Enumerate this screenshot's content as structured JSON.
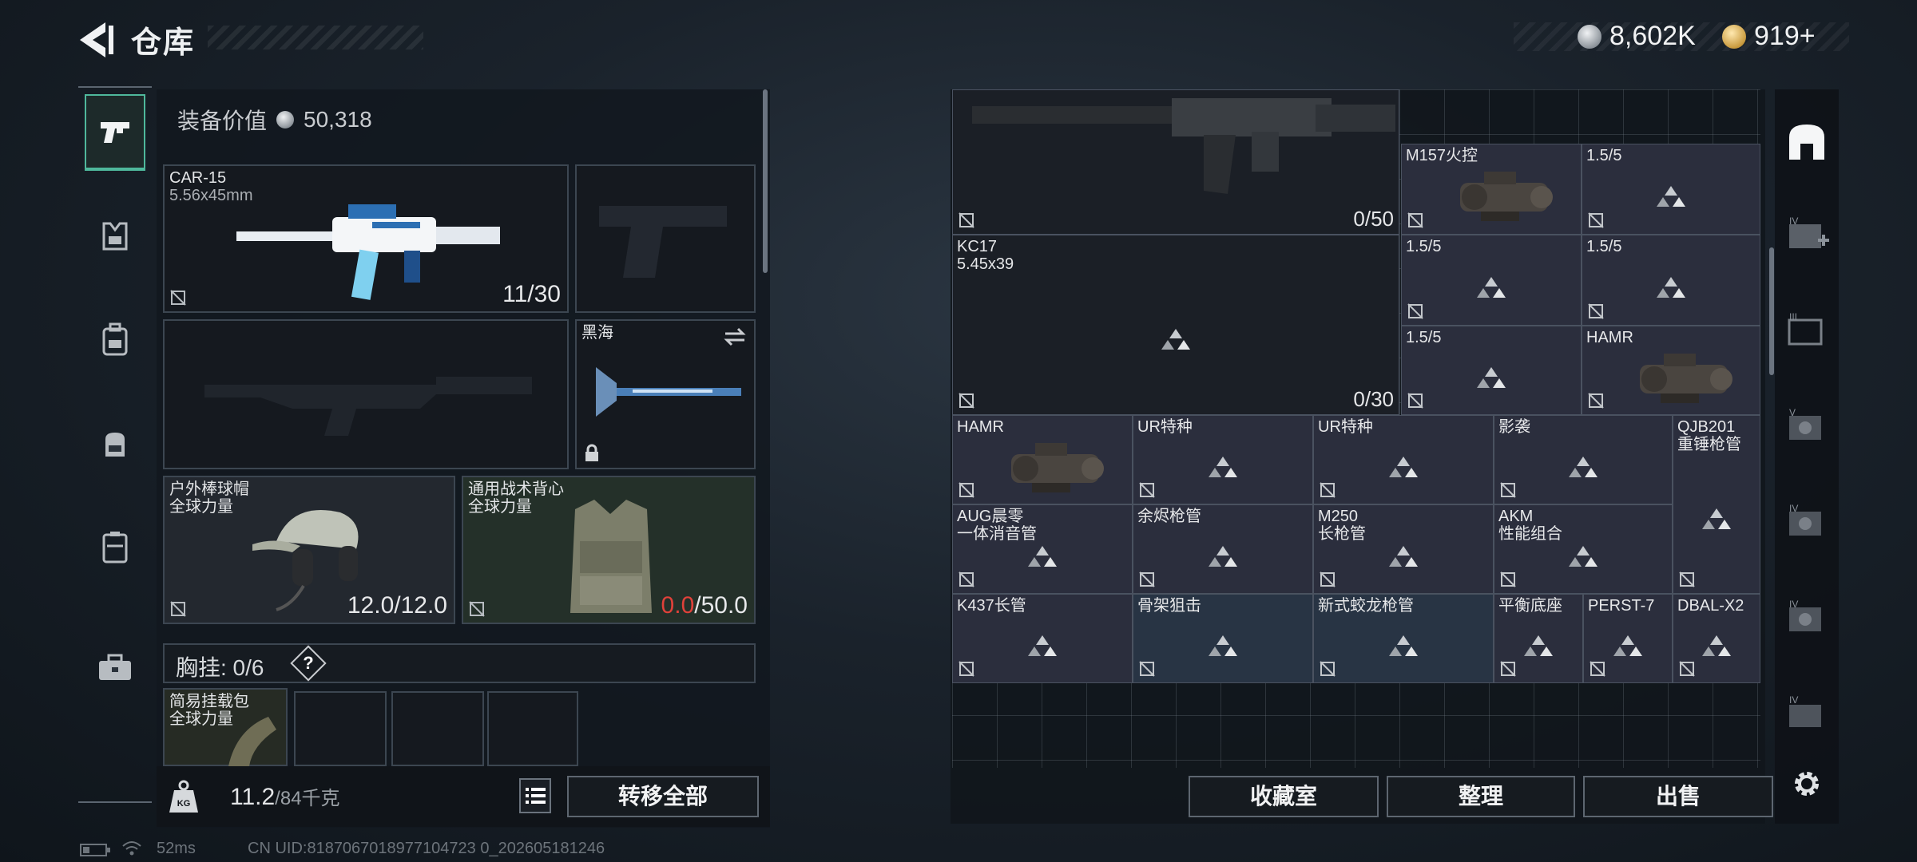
{
  "header": {
    "title": "仓库"
  },
  "currency": [
    {
      "icon": "silver-coin-icon",
      "value": "8,602K"
    },
    {
      "icon": "gold-coin-icon",
      "value": "919+"
    }
  ],
  "rail": {
    "items": [
      {
        "name": "pistol-icon"
      },
      {
        "name": "armor-icon"
      },
      {
        "name": "backpack-rig-icon"
      },
      {
        "name": "backpack-icon"
      },
      {
        "name": "case-icon"
      },
      {
        "name": "toolbox-icon"
      }
    ]
  },
  "loadout": {
    "value_label": "装备价值",
    "value": "50,318",
    "primary": {
      "name": "CAR-15",
      "ammo": "5.56x45mm",
      "count": "11/30"
    },
    "melee": {
      "name": "黑海"
    },
    "helmet": {
      "name": "户外棒球帽",
      "sub": "全球力量",
      "count": "12.0/12.0"
    },
    "vest": {
      "name": "通用战术背心",
      "sub": "全球力量",
      "count_current": "0.0",
      "count_max": "/50.0"
    },
    "rig": {
      "label": "胸挂: 0/6",
      "help": "?"
    },
    "rig_item": {
      "name": "简易挂载包",
      "sub": "全球力量"
    },
    "weight": {
      "value": "11.2",
      "max": "/84千克",
      "badge": "KG"
    },
    "transfer_all": "转移全部"
  },
  "storage": {
    "items": [
      {
        "id": "rifle-large",
        "count": "0/50"
      },
      {
        "id": "m157",
        "name": "M157火控"
      },
      {
        "id": "c-1-5-a",
        "name": "1.5/5"
      },
      {
        "id": "kc17",
        "name": "KC17",
        "sub": "5.45x39",
        "count": "0/30"
      },
      {
        "id": "c-1-5-b",
        "name": "1.5/5"
      },
      {
        "id": "c-1-5-c",
        "name": "1.5/5"
      },
      {
        "id": "c-1-5-d",
        "name": "1.5/5"
      },
      {
        "id": "hamr-a",
        "name": "HAMR"
      },
      {
        "id": "hamr-b",
        "name": "HAMR"
      },
      {
        "id": "ur-a",
        "name": "UR特种"
      },
      {
        "id": "ur-b",
        "name": "UR特种"
      },
      {
        "id": "yingxi",
        "name": "影袭"
      },
      {
        "id": "qjb201",
        "name": "QJB201",
        "sub": "重锤枪管"
      },
      {
        "id": "aug",
        "name": "AUG晨零",
        "sub": "一体消音管"
      },
      {
        "id": "yujin",
        "name": "余烬枪管"
      },
      {
        "id": "m250",
        "name": "M250",
        "sub": "长枪管"
      },
      {
        "id": "akm",
        "name": "AKM",
        "sub": "性能组合"
      },
      {
        "id": "k437",
        "name": "K437长管"
      },
      {
        "id": "gujia",
        "name": "骨架狙击"
      },
      {
        "id": "jiaolong",
        "name": "新式蛟龙枪管"
      },
      {
        "id": "pingheng",
        "name": "平衡底座"
      },
      {
        "id": "perst",
        "name": "PERST-7"
      },
      {
        "id": "dbal",
        "name": "DBAL-X2"
      }
    ],
    "buttons": {
      "collection": "收藏室",
      "sort": "整理",
      "sell": "出售"
    }
  },
  "status": {
    "ping": "52ms",
    "uid": "CN UID:8187067018977104723 0_202605181246"
  }
}
